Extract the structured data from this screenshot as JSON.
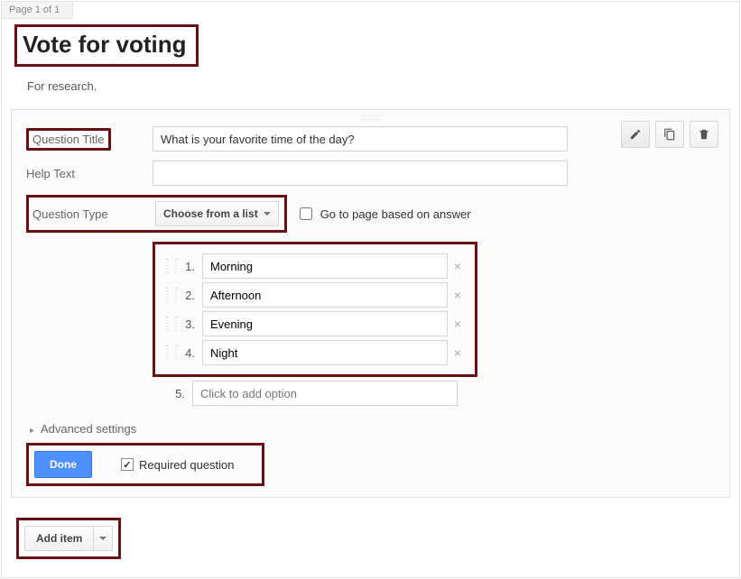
{
  "page_indicator": "Page 1 of 1",
  "form": {
    "title": "Vote for voting",
    "description": "For research."
  },
  "labels": {
    "question_title": "Question Title",
    "help_text": "Help Text",
    "question_type": "Question Type",
    "goto_page": "Go to page based on answer",
    "advanced": "Advanced settings",
    "done": "Done",
    "required": "Required question",
    "add_item": "Add item",
    "add_option_placeholder": "Click to add option"
  },
  "question": {
    "title": "What is your favorite time of the day?",
    "help_text": "",
    "type_label": "Choose from a list",
    "goto_page_checked": false,
    "required_checked": true,
    "options": [
      {
        "n": "1.",
        "text": "Morning"
      },
      {
        "n": "2.",
        "text": "Afternoon"
      },
      {
        "n": "3.",
        "text": "Evening"
      },
      {
        "n": "4.",
        "text": "Night"
      }
    ],
    "next_option_n": "5."
  }
}
